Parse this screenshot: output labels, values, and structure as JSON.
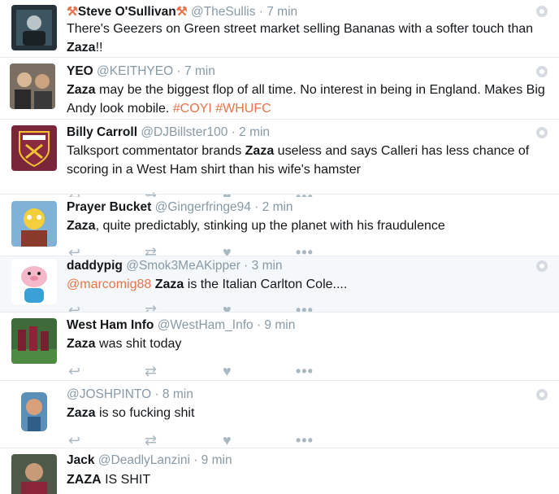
{
  "tweets": [
    {
      "name": "Steve O'Sullivan",
      "name_prefix": "⚒",
      "name_suffix": "⚒",
      "handle": "@TheSullis",
      "time": "· 7 min",
      "text_a": "There's Geezers on Green street market selling Bananas with a softer touch than ",
      "kw": "Zaza",
      "text_b": "!!"
    },
    {
      "name": "YEO",
      "handle": "@KEITHYEO",
      "time": "· 7 min",
      "kw": "Zaza",
      "text_a": " may be the biggest flop of all time. No interest in being in England. Makes Big Andy look mobile. ",
      "tag1": "#COYI",
      "tag2": "#WHUFC"
    },
    {
      "name": "Billy Carroll",
      "handle": "@DJBillster100",
      "time": "· 2 min",
      "text_a": "Talksport commentator brands ",
      "kw": "Zaza",
      "text_b": " useless and says Calleri has less chance of scoring in a West Ham shirt than his wife's hamster"
    },
    {
      "name": "Prayer Bucket",
      "handle": "@Gingerfringe94",
      "time": "· 2 min",
      "kw": "Zaza",
      "text_a": ", quite predictably, stinking up the planet with his fraudulence"
    },
    {
      "name": "daddypig",
      "handle": "@Smok3MeAKipper",
      "time": "· 3 min",
      "mention": "@marcomig88",
      "kw": "Zaza",
      "text_a": " is the Italian Carlton Cole...."
    },
    {
      "name": "West Ham Info",
      "handle": "@WestHam_Info",
      "time": "· 9 min",
      "kw": "Zaza",
      "text_a": " was shit today"
    },
    {
      "name": "",
      "handle": "@JOSHPINTO",
      "time": "· 8 min",
      "kw": "Zaza",
      "text_a": " is so fucking shit"
    },
    {
      "name": "Jack",
      "handle": "@DeadlyLanzini",
      "time": "· 9 min",
      "kw": "ZAZA",
      "text_a": " IS SHIT"
    }
  ],
  "icons": {
    "reply": "↩",
    "retweet": "⇄",
    "like": "♥",
    "more": "•••"
  },
  "colors": {
    "hashtag": "#e8734a",
    "handle": "#8899a6",
    "action_icon": "#aab8c2",
    "highlight_bg": "#f5f8fa"
  }
}
